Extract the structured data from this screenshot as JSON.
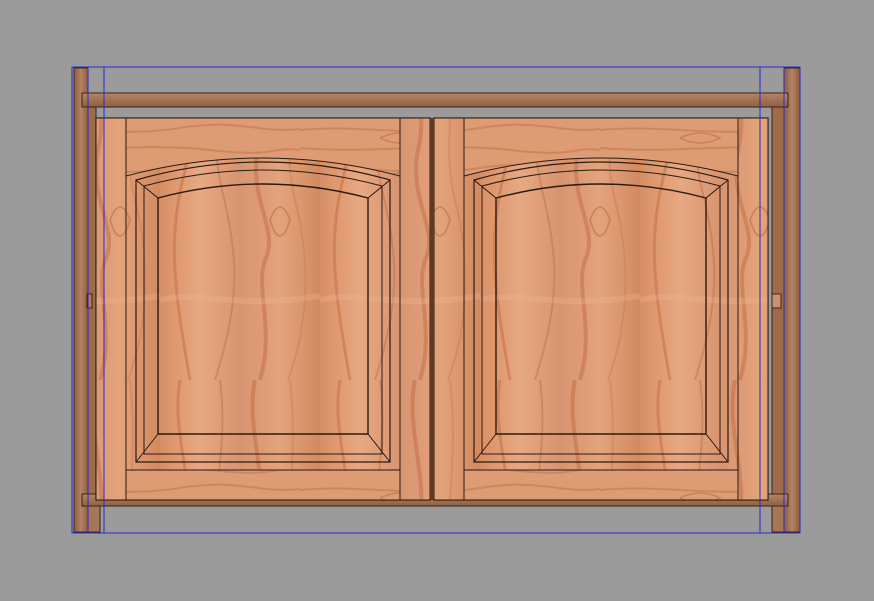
{
  "viewport": {
    "background": "#9b9b9b",
    "selection_color": "#2a2ad0"
  },
  "cabinet": {
    "door_count": 2,
    "door_style": "cathedral-arch-raised-panel",
    "wood": "cherry",
    "colors": {
      "light": "#e2a27a",
      "mid": "#cf8a62",
      "dark": "#a9643f",
      "grain": "#c0683f",
      "frame": "#a57658",
      "frame_dark": "#7d5339",
      "edge": "#2b1a10"
    }
  }
}
